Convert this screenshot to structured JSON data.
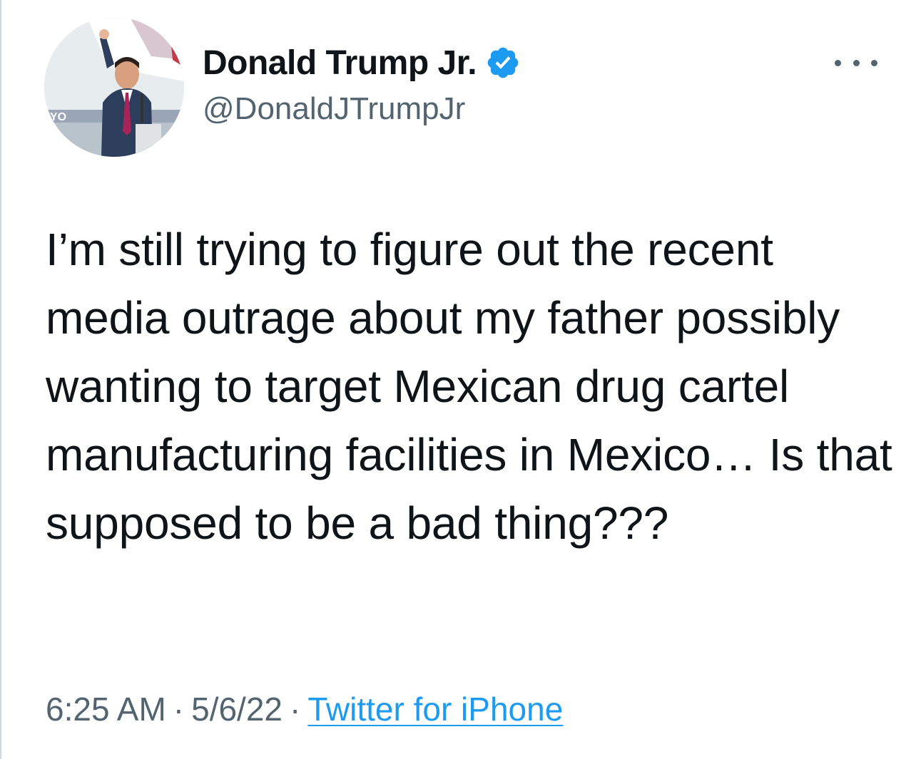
{
  "tweet": {
    "author": {
      "display_name": "Donald Trump Jr.",
      "handle": "@DonaldJTrumpJr",
      "verified": true,
      "verified_icon": "verified-badge-icon",
      "avatar_icon": "avatar-photo",
      "avatar_banner_text": "YO"
    },
    "more_icon": "more-options-icon",
    "text": "I’m still trying to figure out the recent media outrage about my father possibly wanting to target Mexican drug cartel manufacturing facilities in Mexico… Is that supposed to be a bad thing???",
    "time": "6:25 AM",
    "separator": "·",
    "date": "5/6/22",
    "source": "Twitter for iPhone"
  },
  "colors": {
    "text_primary": "#0f1419",
    "text_secondary": "#536471",
    "link": "#1d9bf0",
    "verified": "#1d9bf0"
  }
}
